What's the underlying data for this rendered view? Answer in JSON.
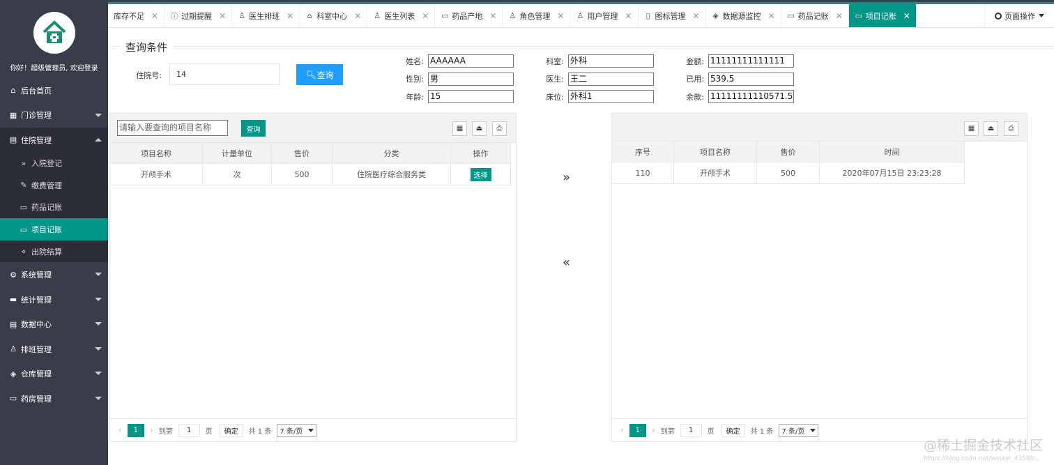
{
  "sidebar": {
    "welcome": "你好！超级管理员, 欢迎登录",
    "items": [
      {
        "label": "后台首页",
        "icon": "home-icon"
      },
      {
        "label": "门诊管理",
        "icon": "apps-icon"
      },
      {
        "label": "住院管理",
        "icon": "list-icon"
      },
      {
        "label": "系统管理",
        "icon": "gear-icon"
      },
      {
        "label": "统计管理",
        "icon": "chart-icon"
      },
      {
        "label": "数据中心",
        "icon": "document-icon"
      },
      {
        "label": "排班管理",
        "icon": "user-icon"
      },
      {
        "label": "仓库管理",
        "icon": "cube-icon"
      },
      {
        "label": "药房管理",
        "icon": "book-icon"
      }
    ],
    "sub_items": [
      {
        "label": "入院登记"
      },
      {
        "label": "缴费管理"
      },
      {
        "label": "药品记账"
      },
      {
        "label": "项目记账"
      },
      {
        "label": "出院结算"
      }
    ]
  },
  "tabs": [
    {
      "label": "库存不足"
    },
    {
      "label": "过期提醒"
    },
    {
      "label": "医生排班"
    },
    {
      "label": "科室中心"
    },
    {
      "label": "医生列表"
    },
    {
      "label": "药品产地"
    },
    {
      "label": "角色管理"
    },
    {
      "label": "用户管理"
    },
    {
      "label": "图标管理"
    },
    {
      "label": "数据源监控"
    },
    {
      "label": "药品记账"
    },
    {
      "label": "项目记账"
    }
  ],
  "page_ops": "页面操作",
  "query": {
    "legend": "查询条件",
    "hosp_label": "住院号:",
    "hosp_value": "14",
    "button": "查询"
  },
  "patient": {
    "name_label": "姓名:",
    "name": "AAAAAA",
    "gender_label": "性别:",
    "gender": "男",
    "age_label": "年龄:",
    "age": "15",
    "dept_label": "科室:",
    "dept": "外科",
    "doctor_label": "医生:",
    "doctor": "王二",
    "bed_label": "床位:",
    "bed": "外科1",
    "amount_label": "金额:",
    "amount": "11111111111111",
    "used_label": "已用:",
    "used": "539.5",
    "balance_label": "余款:",
    "balance": "11111111110571.5"
  },
  "left_table": {
    "search_placeholder": "请输入要查询的项目名称",
    "search_button": "查询",
    "headers": [
      "项目名称",
      "计量单位",
      "售价",
      "分类",
      "操作"
    ],
    "rows": [
      {
        "name": "开颅手术",
        "unit": "次",
        "price": "500",
        "category": "住院医疗综合服务类",
        "action": "选择"
      }
    ]
  },
  "right_table": {
    "headers": [
      "序号",
      "项目名称",
      "售价",
      "时间"
    ],
    "rows": [
      {
        "id": "110",
        "name": "开颅手术",
        "price": "500",
        "time": "2020年07月15日 23:23:28"
      }
    ]
  },
  "pager": {
    "current": "1",
    "goto": "到第",
    "page_input": "1",
    "page_unit": "页",
    "ok": "确定",
    "total": "共 1 条",
    "size": "7 条/页"
  },
  "transfer": {
    "right": "»",
    "left": "«"
  },
  "watermark": "@稀土掘金技术社区",
  "watermark_url": "https://blog.csdn.net/weixin_43580..."
}
